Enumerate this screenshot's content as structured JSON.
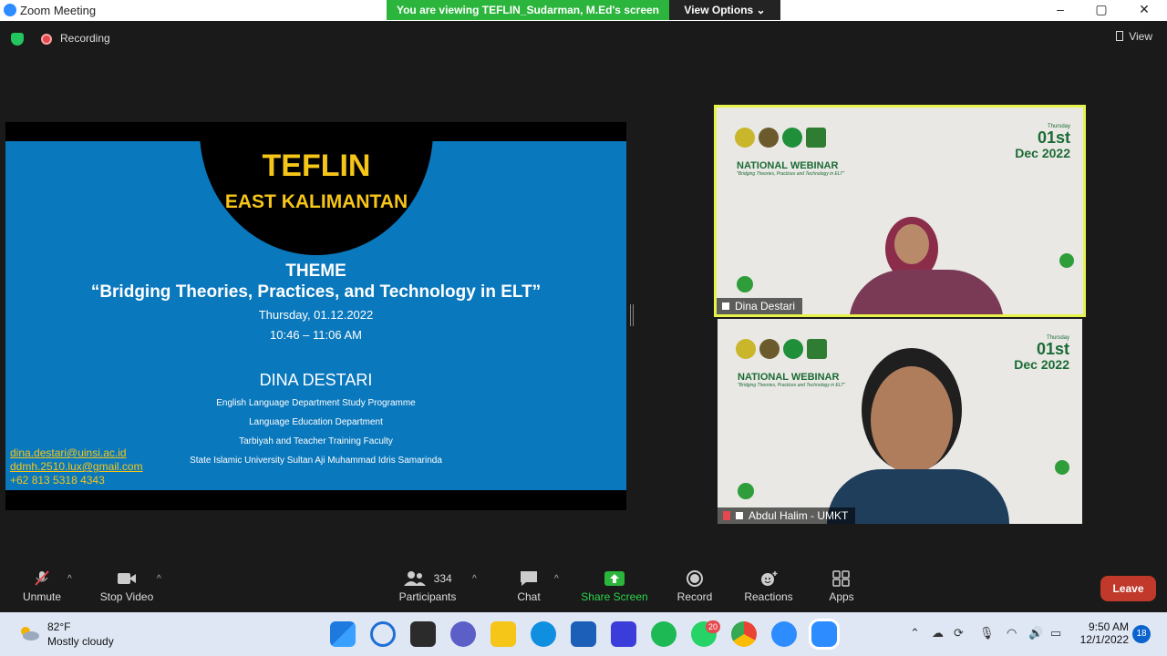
{
  "window": {
    "title": "Zoom Meeting",
    "share_banner": "You are viewing TEFLIN_Sudarman, M.Ed's screen",
    "view_options": "View Options ⌄"
  },
  "topbar": {
    "recording_label": "Recording",
    "view_label": "View"
  },
  "slide": {
    "title": "TEFLIN",
    "subtitle": "EAST KALIMANTAN",
    "theme_label": "THEME",
    "theme_text": "“Bridging Theories, Practices, and Technology in ELT”",
    "date": "Thursday, 01.12.2022",
    "time": "10:46 – 11:06 AM",
    "speaker": "DINA DESTARI",
    "affiliation": [
      "English Language Department Study Programme",
      "Language Education Department",
      "Tarbiyah and Teacher Training Faculty",
      "State Islamic University Sultan Aji Muhammad Idris Samarinda"
    ],
    "contacts": [
      "dina.destari@uinsi.ac.id",
      "ddmh.2510.lux@gmail.com",
      "+62 813 5318 4343"
    ]
  },
  "videos": [
    {
      "name": "Dina Destari",
      "banner": "NATIONAL WEBINAR",
      "banner_sub": "\"Bridging Theories, Practices and Technology in ELT\"",
      "day": "Thursday",
      "date_num": "01st",
      "month_year": "Dec 2022"
    },
    {
      "name": "Abdul Halim - UMKT",
      "banner": "NATIONAL WEBINAR",
      "banner_sub": "\"Bridging Theories, Practices and Technology in ELT\"",
      "day": "Thursday",
      "date_num": "01st",
      "month_year": "Dec 2022"
    }
  ],
  "toolbar": {
    "unmute": "Unmute",
    "stop_video": "Stop Video",
    "participants_count": "334",
    "participants": "Participants",
    "chat": "Chat",
    "share_screen": "Share Screen",
    "record": "Record",
    "reactions": "Reactions",
    "apps": "Apps",
    "leave": "Leave"
  },
  "taskbar": {
    "temp": "82°F",
    "weather": "Mostly cloudy",
    "time": "9:50 AM",
    "date": "12/1/2022",
    "notifications": "18",
    "whatsapp_badge": "20"
  },
  "colors": {
    "share_green": "#2bb53c",
    "slide_blue": "#0a78bd",
    "teflin_yellow": "#f5c518",
    "leave_red": "#c0392b",
    "active_speaker": "#e7f34a"
  }
}
